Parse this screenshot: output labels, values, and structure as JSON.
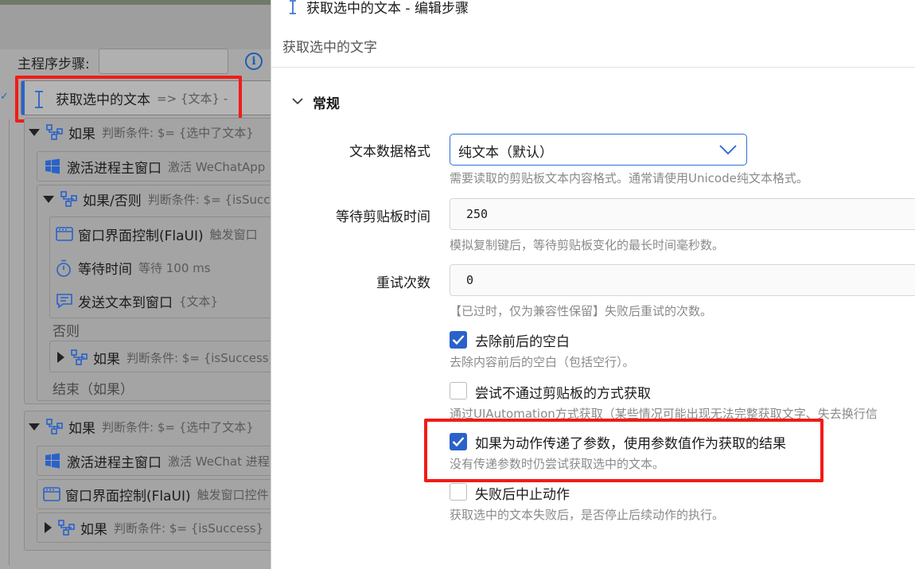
{
  "left_panel": {
    "main_steps_label": "主程序步骤:",
    "selected_step": {
      "name": "获取选中的文本",
      "detail": "=> {文本} -"
    },
    "rows": [
      {
        "name": "如果",
        "detail": "判断条件: $= {选中了文本}"
      },
      {
        "name": "激活进程主窗口",
        "detail": "激活 WeChatApp"
      },
      {
        "name": "如果/否则",
        "detail": "判断条件: $= {isSuccess}"
      },
      {
        "name": "窗口界面控制(FlaUI)",
        "detail": "触发窗口"
      },
      {
        "name": "等待时间",
        "detail": "等待 100 ms"
      },
      {
        "name": "发送文本到窗口",
        "detail": "{文本}"
      },
      {
        "name": "否则",
        "detail": ""
      },
      {
        "name": "如果",
        "detail": "判断条件: $= {isSuccess}"
      },
      {
        "name": "结束（如果）",
        "detail": ""
      },
      {
        "name": "如果",
        "detail": "判断条件: $= {选中了文本}"
      },
      {
        "name": "激活进程主窗口",
        "detail": "激活 WeChat 进程"
      },
      {
        "name": "窗口界面控制(FlaUI)",
        "detail": "触发窗口控件"
      },
      {
        "name": "如果",
        "detail": "判断条件: $= {isSuccess}"
      }
    ]
  },
  "dialog": {
    "title": "获取选中的文本  -  编辑步骤",
    "subtitle": "获取选中的文字",
    "section": "常规",
    "format": {
      "label": "文本数据格式",
      "value": "纯文本（默认）",
      "help": "需要读取的剪贴板文本内容格式。通常请使用Unicode纯文本格式。"
    },
    "wait": {
      "label": "等待剪贴板时间",
      "value": "250",
      "help": "模拟复制键后，等待剪贴板变化的最长时间毫秒数。"
    },
    "retry": {
      "label": "重试次数",
      "value": "0",
      "help": "【已过时，仅为兼容性保留】失败后重试的次数。"
    },
    "checks": [
      {
        "label": "去除前后的空白",
        "help": "去除内容前后的空白（包括空行）。",
        "checked": true
      },
      {
        "label": "尝试不通过剪贴板的方式获取",
        "help": "通过UIAutomation方式获取（某些情况可能出现无法完整获取文字、失去换行信",
        "checked": false
      },
      {
        "label": "如果为动作传递了参数，使用参数值作为获取的结果",
        "help": "没有传递参数时仍尝试获取选中的文本。",
        "checked": true
      },
      {
        "label": "失败后中止动作",
        "help": "获取选中的文本失败后，是否停止后续动作的执行。",
        "checked": false
      }
    ]
  },
  "colors": {
    "accent": "#2a62c9",
    "highlight": "#f21b16"
  }
}
